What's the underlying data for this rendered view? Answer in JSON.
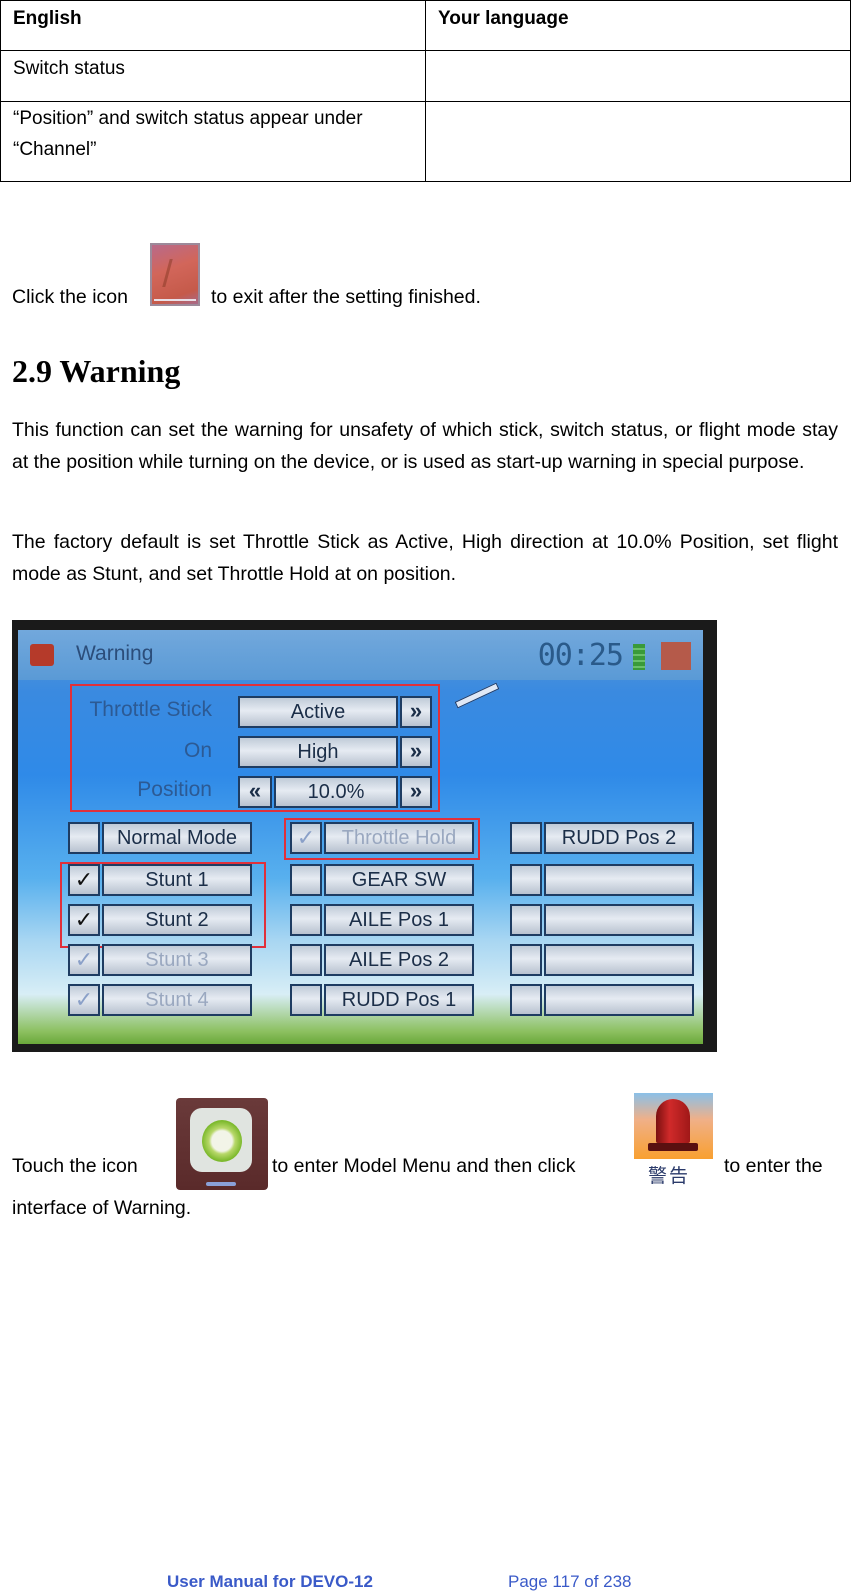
{
  "table": {
    "headers": [
      "English",
      "Your language"
    ],
    "rows": [
      [
        "Switch status",
        ""
      ],
      [
        "“Position” and switch status appear under “Channel”",
        ""
      ]
    ]
  },
  "exit_paragraph": {
    "before": "Click the icon",
    "after": "to exit after the setting finished.",
    "icon": "exit-icon"
  },
  "section": {
    "title": "2.9 Warning",
    "paragraphs": [
      "This function can set the warning for unsafety of which stick, switch status, or flight mode stay at the position while turning on the device, or is used as start-up warning in special purpose.",
      "The factory default is set Throttle Stick as Active, High direction at 10.0% Position, set flight mode as Stunt, and set Throttle Hold at on position."
    ]
  },
  "device_screen": {
    "title": "Warning",
    "timer": "00:25",
    "settings": [
      {
        "label": "Throttle Stick",
        "value": "Active",
        "has_prev": false
      },
      {
        "label": "On",
        "value": "High",
        "has_prev": false
      },
      {
        "label": "Position",
        "value": "10.0%",
        "has_prev": true
      }
    ],
    "arrow_next": "»",
    "arrow_prev": "«",
    "check_mark": "✓",
    "columns": [
      [
        {
          "label": "Normal Mode",
          "checked": false,
          "enabled": true
        },
        {
          "label": "Stunt 1",
          "checked": true,
          "enabled": true
        },
        {
          "label": "Stunt 2",
          "checked": true,
          "enabled": true
        },
        {
          "label": "Stunt 3",
          "checked": true,
          "enabled": false
        },
        {
          "label": "Stunt 4",
          "checked": true,
          "enabled": false
        }
      ],
      [
        {
          "label": "Throttle Hold",
          "checked": true,
          "enabled": false
        },
        {
          "label": "GEAR SW",
          "checked": false,
          "enabled": true
        },
        {
          "label": "AILE Pos 1",
          "checked": false,
          "enabled": true
        },
        {
          "label": "AILE Pos 2",
          "checked": false,
          "enabled": true
        },
        {
          "label": "RUDD Pos 1",
          "checked": false,
          "enabled": true
        }
      ],
      [
        {
          "label": "RUDD Pos 2",
          "checked": false,
          "enabled": true
        },
        {
          "label": "",
          "checked": false,
          "enabled": false
        },
        {
          "label": "",
          "checked": false,
          "enabled": false
        },
        {
          "label": "",
          "checked": false,
          "enabled": false
        },
        {
          "label": "",
          "checked": false,
          "enabled": false
        }
      ]
    ],
    "highlight_color": "#e0303a"
  },
  "touch_paragraph": {
    "part1": "Touch the icon",
    "part2": "to enter Model Menu and then click",
    "part3": "to enter the",
    "line2": "interface of Warning.",
    "siren_caption": "警告"
  },
  "footer": {
    "manual": "User Manual for DEVO-12",
    "page": "Page 117 of 238",
    "color": "#3a5ac8"
  }
}
